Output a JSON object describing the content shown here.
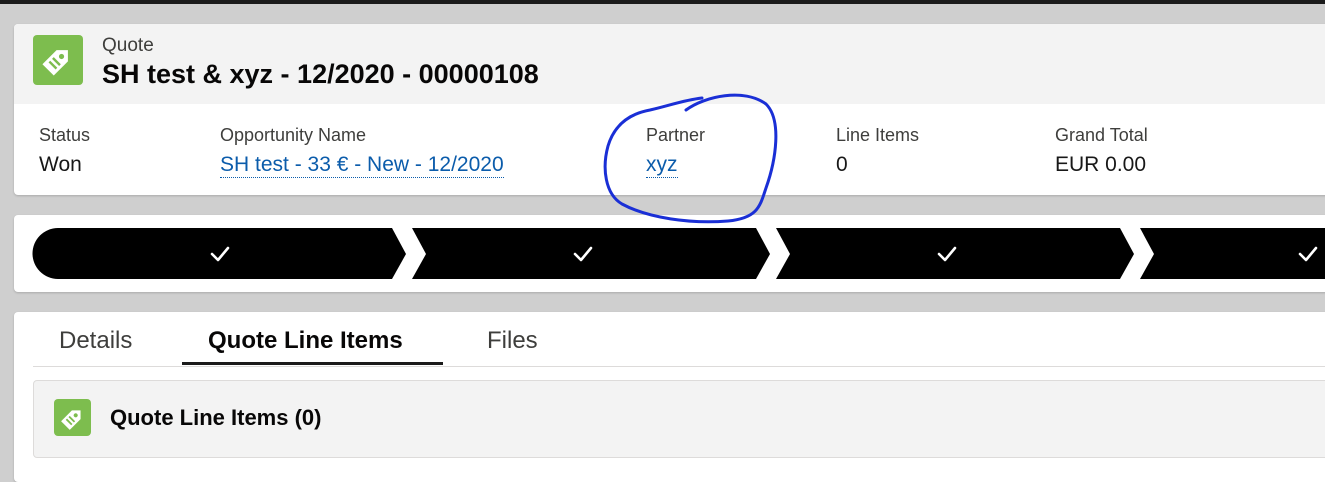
{
  "header": {
    "object_type": "Quote",
    "record_title": "SH test & xyz - 12/2020 - 00000108",
    "icon": "price-tag-icon",
    "accent_color": "#7dbd4e"
  },
  "highlights": {
    "status": {
      "label": "Status",
      "value": "Won"
    },
    "opportunity": {
      "label": "Opportunity Name",
      "value": "SH test - 33 € - New - 12/2020"
    },
    "partner": {
      "label": "Partner",
      "value": "xyz"
    },
    "line_items": {
      "label": "Line Items",
      "value": "0"
    },
    "grand_total": {
      "label": "Grand Total",
      "value": "EUR 0.00"
    }
  },
  "path": {
    "stages": [
      {
        "icon": "check-icon",
        "state": "complete"
      },
      {
        "icon": "check-icon",
        "state": "complete"
      },
      {
        "icon": "check-icon",
        "state": "complete"
      },
      {
        "icon": "check-icon",
        "state": "complete"
      }
    ],
    "color": "#000000"
  },
  "tabs": {
    "details": "Details",
    "quote_line_items": "Quote Line Items",
    "files": "Files",
    "active": "quote_line_items"
  },
  "related_list": {
    "title": "Quote Line Items (0)",
    "icon": "price-tag-icon"
  },
  "annotation": {
    "shape": "hand-drawn-circle",
    "color": "#1a2fd6",
    "target": "partner"
  }
}
